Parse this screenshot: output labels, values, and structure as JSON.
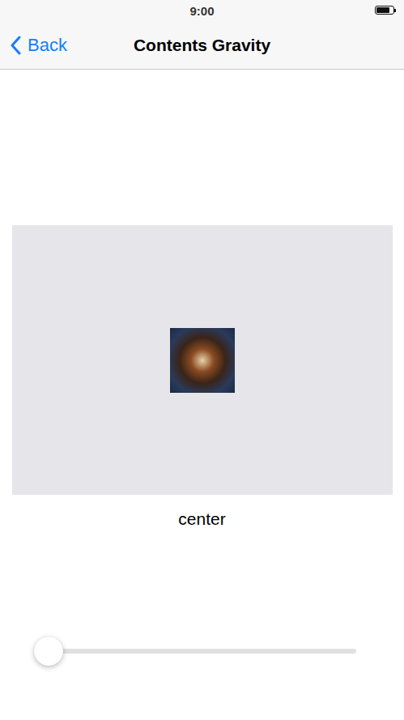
{
  "status_bar": {
    "time": "9:00",
    "battery_level": 0.8
  },
  "nav": {
    "back": "Back",
    "title": "Contents Gravity"
  },
  "preview": {
    "gravity": "center"
  },
  "slider": {
    "level": 0
  }
}
